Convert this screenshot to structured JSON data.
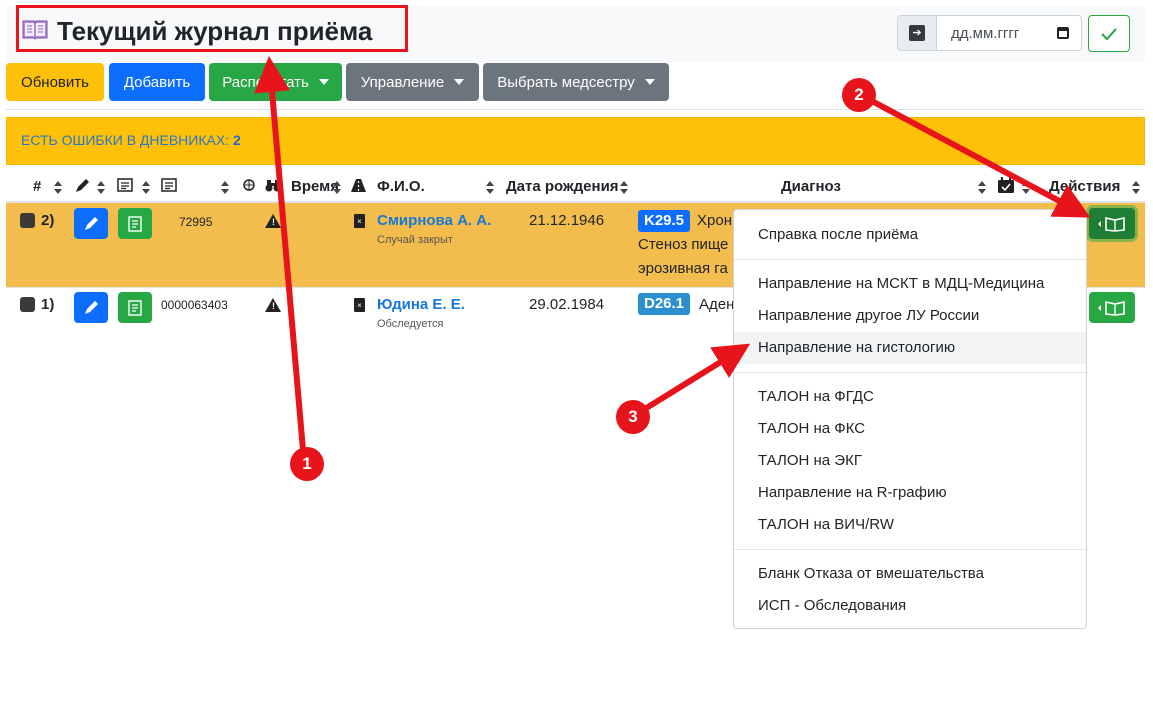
{
  "header": {
    "title": "Текущий журнал приёма",
    "date_placeholder": "дд.мм.гггг"
  },
  "toolbar": {
    "refresh": "Обновить",
    "add": "Добавить",
    "print": "Распечатать",
    "manage": "Управление",
    "nurse": "Выбрать медсестру"
  },
  "alert": {
    "text": "ЕСТЬ ОШИБКИ В ДНЕВНИКАХ: ",
    "count": "2"
  },
  "table": {
    "headers": {
      "num": "#",
      "time": "Время",
      "name": "Ф.И.О.",
      "dob": "Дата рождения",
      "diagnosis": "Диагноз",
      "actions": "Действия"
    },
    "rows": [
      {
        "index": "2)",
        "number": "72995",
        "name": "Смирнова А. А.",
        "status": "Случай закрыт",
        "dob": "21.12.1946",
        "code": "K29.5",
        "diag_line1": "Хрон",
        "diag_line2": "Стеноз пище",
        "diag_line3": "эрозивная га"
      },
      {
        "index": "1)",
        "number": "0000063403",
        "name": "Юдина Е. Е.",
        "status": "Обследуется",
        "dob": "29.02.1984",
        "code": "D26.1",
        "diag_line1": "Аден"
      }
    ]
  },
  "menu": {
    "items": [
      "Справка после приёма",
      "Направление на МСКТ в МДЦ-Медицина",
      "Направление другое ЛУ России",
      "Направление на гистологию",
      "ТАЛОН на ФГДС",
      "ТАЛОН на ФКС",
      "ТАЛОН на ЭКГ",
      "Направление на R-графию",
      "ТАЛОН на ВИЧ/RW",
      "Бланк Отказа от вмешательства",
      "ИСП - Обследования"
    ]
  },
  "annotations": {
    "badge1": "1",
    "badge2": "2",
    "badge3": "3",
    "color": "#e8141c"
  }
}
